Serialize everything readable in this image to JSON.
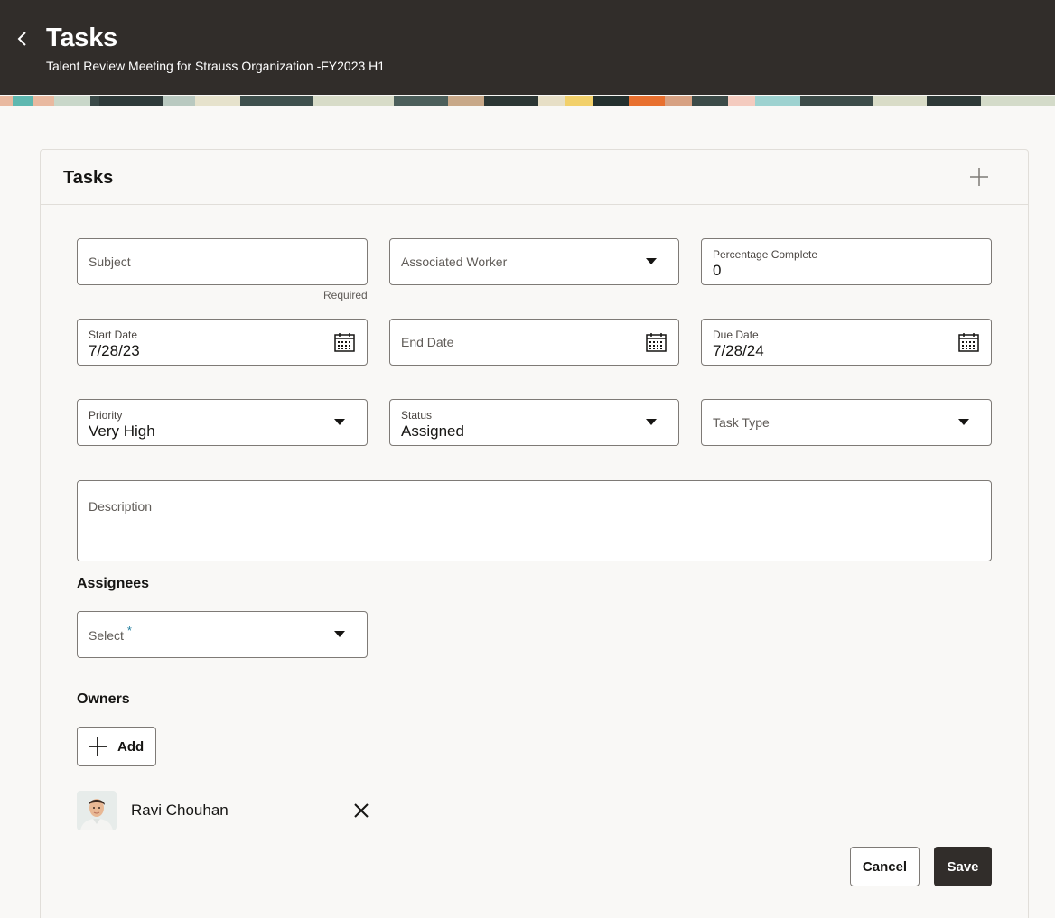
{
  "header": {
    "title": "Tasks",
    "subtitle": "Talent Review Meeting for Strauss Organization -FY2023 H1",
    "background_color": "#312d2a"
  },
  "card": {
    "title": "Tasks",
    "add_icon": "plus-icon"
  },
  "form": {
    "subject": {
      "label": "Subject",
      "value": "",
      "note": "Required"
    },
    "associated_worker": {
      "label": "Associated Worker",
      "value": ""
    },
    "percentage_complete": {
      "label": "Percentage Complete",
      "value": "0"
    },
    "start_date": {
      "label": "Start Date",
      "value": "7/28/23"
    },
    "end_date": {
      "label": "End Date",
      "value": ""
    },
    "due_date": {
      "label": "Due Date",
      "value": "7/28/24"
    },
    "priority": {
      "label": "Priority",
      "value": "Very High"
    },
    "status": {
      "label": "Status",
      "value": "Assigned"
    },
    "task_type": {
      "label": "Task Type",
      "value": ""
    },
    "description": {
      "label": "Description",
      "value": ""
    }
  },
  "assignees": {
    "title": "Assignees",
    "select_label": "Select",
    "required_mark": "*"
  },
  "owners": {
    "title": "Owners",
    "add_label": "Add",
    "items": [
      {
        "name": "Ravi Chouhan"
      }
    ]
  },
  "actions": {
    "cancel_label": "Cancel",
    "save_label": "Save"
  },
  "colors": {
    "accent_dark": "#312d2a",
    "required_asterisk": "#227e9e",
    "border": "#7e7a76"
  }
}
